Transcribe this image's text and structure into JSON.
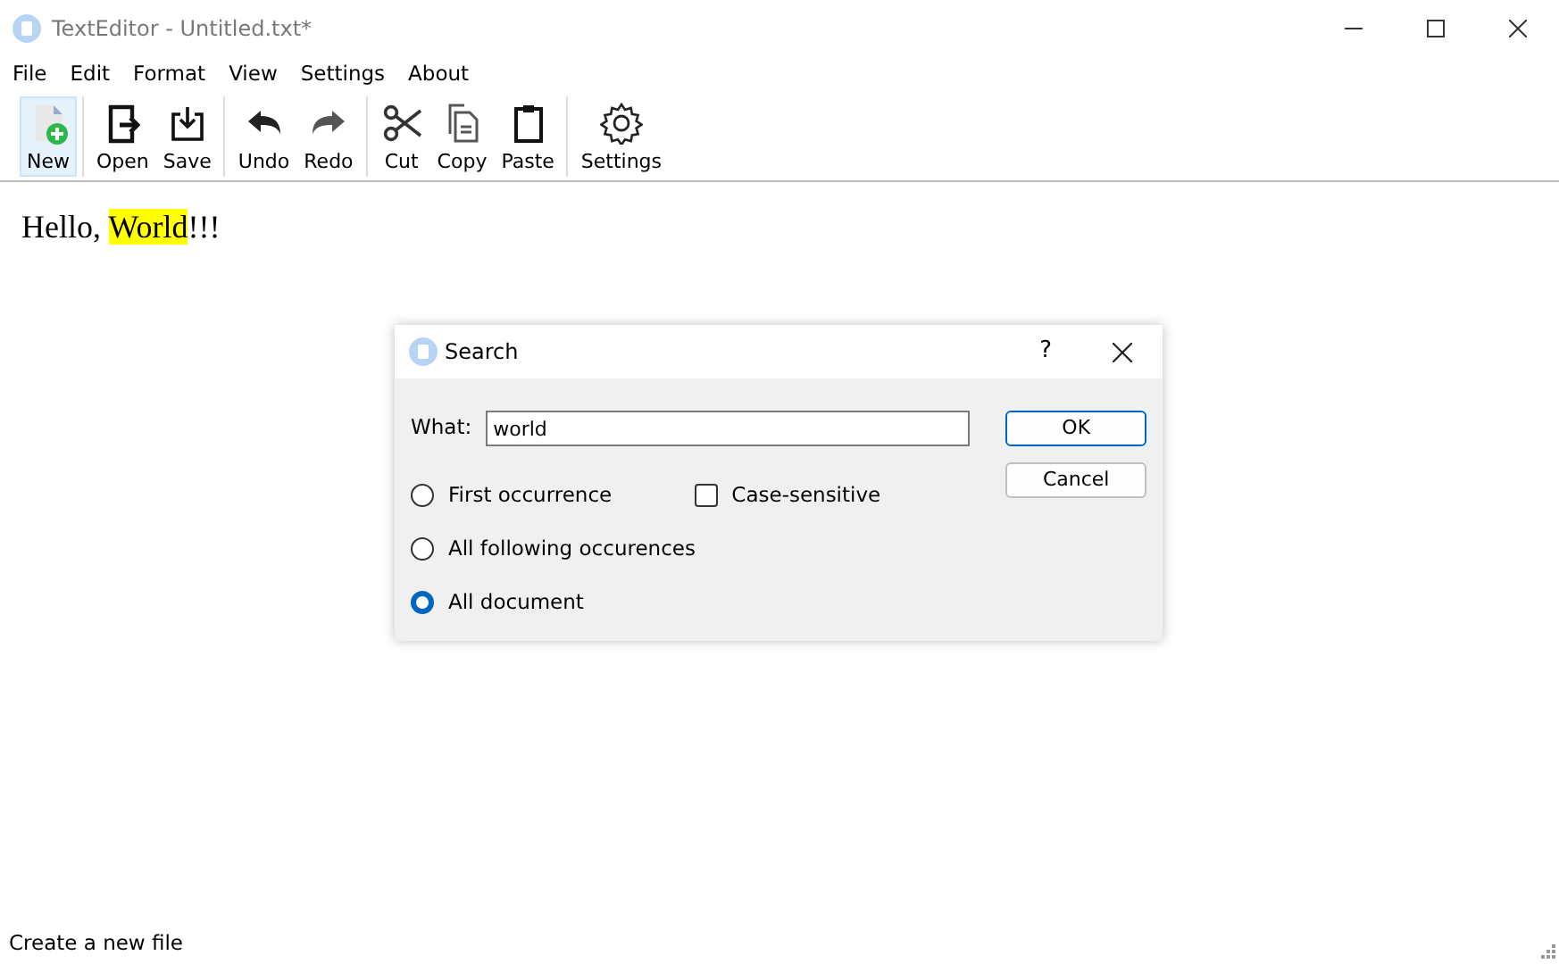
{
  "window": {
    "title": "TextEditor - Untitled.txt*"
  },
  "menu": [
    "File",
    "Edit",
    "Format",
    "View",
    "Settings",
    "About"
  ],
  "toolbar": [
    [
      {
        "label": "New",
        "selected": true
      }
    ],
    [
      {
        "label": "Open",
        "selected": false
      },
      {
        "label": "Save",
        "selected": false
      }
    ],
    [
      {
        "label": "Undo",
        "selected": false
      },
      {
        "label": "Redo",
        "selected": false
      }
    ],
    [
      {
        "label": "Cut",
        "selected": false
      },
      {
        "label": "Copy",
        "selected": false
      },
      {
        "label": "Paste",
        "selected": false
      }
    ],
    [
      {
        "label": "Settings",
        "selected": false
      }
    ]
  ],
  "editor": {
    "segments": [
      {
        "text": "Hello, ",
        "highlighted": false
      },
      {
        "text": "World",
        "highlighted": true
      },
      {
        "text": "!!!",
        "highlighted": false
      }
    ]
  },
  "dialog": {
    "title": "Search",
    "help": "?",
    "field_label": "What:",
    "value": "world",
    "options": [
      {
        "label": "First occurrence",
        "selected": false
      },
      {
        "label": "All following occurences",
        "selected": false
      },
      {
        "label": "All document",
        "selected": true
      }
    ],
    "case_sensitive": {
      "label": "Case-sensitive",
      "checked": false
    },
    "buttons": [
      {
        "label": "OK",
        "default": true
      },
      {
        "label": "Cancel",
        "default": false
      }
    ]
  },
  "status_bar": "Create a new file"
}
